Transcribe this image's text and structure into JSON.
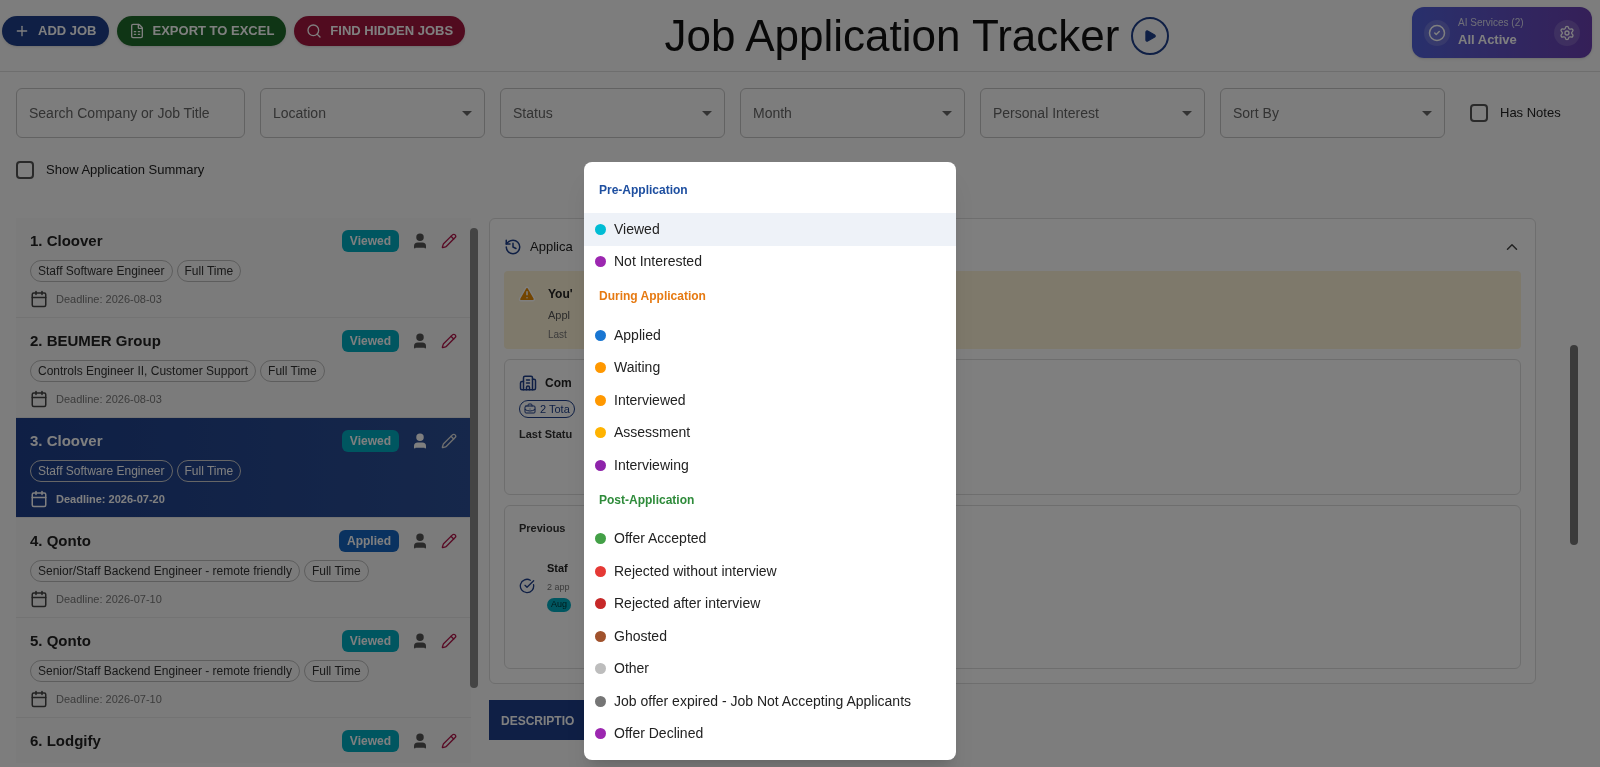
{
  "toolbar": {
    "buttons": [
      {
        "label": "ADD JOB",
        "kind": "add"
      },
      {
        "label": "EXPORT TO EXCEL",
        "kind": "export"
      },
      {
        "label": "FIND HIDDEN JOBS",
        "kind": "find"
      }
    ]
  },
  "title": "Job Application Tracker",
  "ai_services": {
    "label": "AI Services (2)",
    "status": "All Active"
  },
  "filters": {
    "search": {
      "placeholder": "Search Company or Job Title"
    },
    "selects": [
      {
        "placeholder": "Location"
      },
      {
        "placeholder": "Status"
      },
      {
        "placeholder": "Month"
      },
      {
        "placeholder": "Personal Interest"
      },
      {
        "placeholder": "Sort By"
      }
    ],
    "has_notes": {
      "label": "Has Notes",
      "checked": false
    }
  },
  "summary_toggle": {
    "label": "Show Application Summary",
    "checked": false
  },
  "jobs": [
    {
      "title": "1. Cloover",
      "badge": {
        "label": "Viewed",
        "kind": "viewed"
      },
      "tags": [
        "Staff Software Engineer",
        "Full Time"
      ],
      "deadline": "Deadline: 2026-08-03",
      "selected": false
    },
    {
      "title": "2. BEUMER Group",
      "badge": {
        "label": "Viewed",
        "kind": "viewed"
      },
      "tags": [
        "Controls Engineer II, Customer Support",
        "Full Time"
      ],
      "deadline": "Deadline: 2026-08-03",
      "selected": false
    },
    {
      "title": "3. Cloover",
      "badge": {
        "label": "Viewed",
        "kind": "viewed"
      },
      "tags": [
        "Staff Software Engineer",
        "Full Time"
      ],
      "deadline": "Deadline: 2026-07-20",
      "selected": true
    },
    {
      "title": "4. Qonto",
      "badge": {
        "label": "Applied",
        "kind": "applied"
      },
      "tags": [
        "Senior/Staff Backend Engineer - remote friendly",
        "Full Time"
      ],
      "deadline": "Deadline: 2026-07-10",
      "selected": false
    },
    {
      "title": "5. Qonto",
      "badge": {
        "label": "Viewed",
        "kind": "viewed"
      },
      "tags": [
        "Senior/Staff Backend Engineer - remote friendly",
        "Full Time"
      ],
      "deadline": "Deadline: 2026-07-10",
      "selected": false
    },
    {
      "title": "6. Lodgify",
      "badge": {
        "label": "Viewed",
        "kind": "viewed"
      },
      "selected": false
    }
  ],
  "detail": {
    "history_title": "Applica",
    "warning": {
      "title": "You'",
      "line_1": "Appl",
      "line_2": "Last"
    },
    "company": {
      "title": "Com",
      "chip": "2 Tota",
      "last_status": "Last Statu"
    },
    "previous": {
      "title": "Previous",
      "entry_title": "Staf",
      "entry_sub": "2 app",
      "entry_badge": "Aug"
    },
    "tabs": [
      {
        "label": "DESCRIPTIO",
        "selected": true
      }
    ]
  },
  "status_menu": {
    "groups": [
      {
        "title": "Pre-Application",
        "color": "#1e4fa0",
        "items": [
          {
            "label": "Viewed",
            "color": "#00bcd4",
            "selected": true
          },
          {
            "label": "Not Interested",
            "color": "#9c27b0",
            "selected": false
          }
        ]
      },
      {
        "title": "During Application",
        "color": "#e67a12",
        "items": [
          {
            "label": "Applied",
            "color": "#1976d2",
            "selected": false
          },
          {
            "label": "Waiting",
            "color": "#ff9800",
            "selected": false
          },
          {
            "label": "Interviewed",
            "color": "#ff9800",
            "selected": false
          },
          {
            "label": "Assessment",
            "color": "#ffb300",
            "selected": false
          },
          {
            "label": "Interviewing",
            "color": "#8e24aa",
            "selected": false
          }
        ]
      },
      {
        "title": "Post-Application",
        "color": "#2e8b3a",
        "items": [
          {
            "label": "Offer Accepted",
            "color": "#43a047",
            "selected": false
          },
          {
            "label": "Rejected without interview",
            "color": "#e53935",
            "selected": false
          },
          {
            "label": "Rejected after interview",
            "color": "#c62828",
            "selected": false
          },
          {
            "label": "Ghosted",
            "color": "#a0522d",
            "selected": false
          },
          {
            "label": "Other",
            "color": "#bdbdbd",
            "selected": false
          },
          {
            "label": "Job offer expired - Job Not Accepting Applicants",
            "color": "#757575",
            "selected": false
          },
          {
            "label": "Offer Declined",
            "color": "#9c27b0",
            "selected": false
          }
        ]
      }
    ]
  }
}
